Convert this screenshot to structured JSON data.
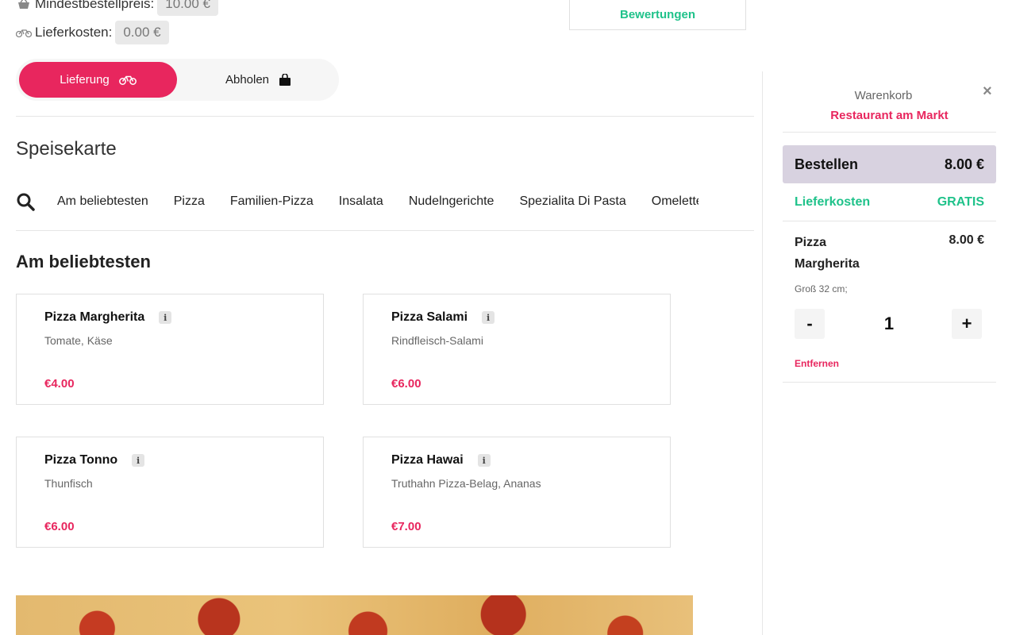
{
  "header": {
    "min_order_label": "Mindestbestellpreis:",
    "min_order_value": "10.00 €",
    "delivery_fee_label": "Lieferkosten:",
    "delivery_fee_value": "0.00 €",
    "reviews_label": "Bewertungen"
  },
  "mode_toggle": {
    "delivery_label": "Lieferung",
    "pickup_label": "Abholen"
  },
  "menu": {
    "title": "Speisekarte",
    "categories": [
      "Am beliebtesten",
      "Pizza",
      "Familien-Pizza",
      "Insalata",
      "Nudelngerichte",
      "Spezialita Di Pasta",
      "Omelette"
    ],
    "section_title": "Am beliebtesten",
    "items": [
      {
        "name": "Pizza Margherita",
        "info": "i",
        "description": "Tomate, Käse",
        "price": "€4.00"
      },
      {
        "name": "Pizza Salami",
        "info": "i",
        "description": "Rindfleisch-Salami",
        "price": "€6.00"
      },
      {
        "name": "Pizza Tonno",
        "info": "i",
        "description": "Thunfisch",
        "price": "€6.00"
      },
      {
        "name": "Pizza Hawai",
        "info": "i",
        "description": "Truthahn Pizza-Belag, Ananas",
        "price": "€7.00"
      }
    ]
  },
  "cart": {
    "title": "Warenkorb",
    "close": "×",
    "restaurant": "Restaurant am Markt",
    "order_label": "Bestellen",
    "order_total": "8.00 €",
    "fee_label": "Lieferkosten",
    "fee_value": "GRATIS",
    "item": {
      "name": "Pizza Margherita",
      "price": "8.00 €",
      "variant": "Groß 32 cm;",
      "minus": "-",
      "quantity": "1",
      "plus": "+",
      "remove": "Entfernen"
    }
  },
  "colors": {
    "accent": "#e8265e",
    "green": "#1fc28a",
    "order_button": "#d8d2e0"
  },
  "icons": {
    "min_order": "shopping-basket-icon",
    "delivery_fee": "bicycle-icon",
    "delivery_mode": "bicycle-icon",
    "pickup_mode": "shopping-bag-icon",
    "search": "search-icon",
    "close": "close-icon",
    "info": "info-icon"
  }
}
